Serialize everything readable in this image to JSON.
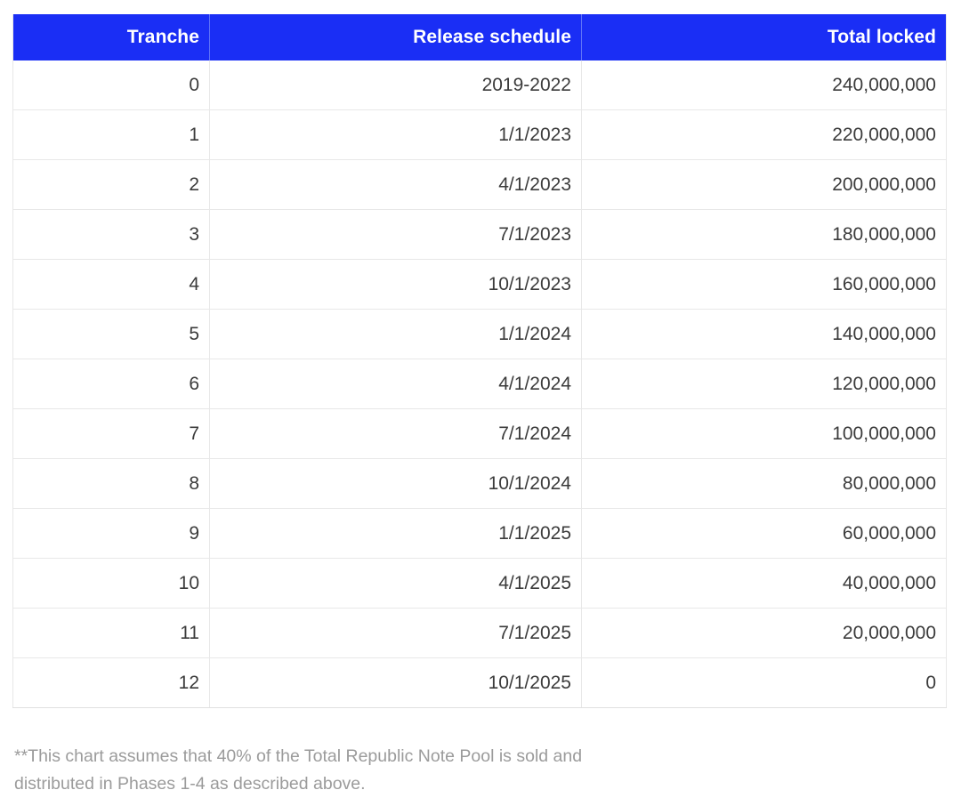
{
  "table": {
    "columns": [
      {
        "key": "tranche",
        "label": "Tranche"
      },
      {
        "key": "schedule",
        "label": "Release schedule"
      },
      {
        "key": "locked",
        "label": "Total locked"
      }
    ],
    "header_bg": "#1a2ef5",
    "header_text_color": "#ffffff",
    "body_text_color": "#3b3b3b",
    "rows": [
      {
        "tranche": "0",
        "schedule": "2019-2022",
        "locked": "240,000,000"
      },
      {
        "tranche": "1",
        "schedule": "1/1/2023",
        "locked": "220,000,000"
      },
      {
        "tranche": "2",
        "schedule": "4/1/2023",
        "locked": "200,000,000"
      },
      {
        "tranche": "3",
        "schedule": "7/1/2023",
        "locked": "180,000,000"
      },
      {
        "tranche": "4",
        "schedule": "10/1/2023",
        "locked": "160,000,000"
      },
      {
        "tranche": "5",
        "schedule": "1/1/2024",
        "locked": "140,000,000"
      },
      {
        "tranche": "6",
        "schedule": "4/1/2024",
        "locked": "120,000,000"
      },
      {
        "tranche": "7",
        "schedule": "7/1/2024",
        "locked": "100,000,000"
      },
      {
        "tranche": "8",
        "schedule": "10/1/2024",
        "locked": "80,000,000"
      },
      {
        "tranche": "9",
        "schedule": "1/1/2025",
        "locked": "60,000,000"
      },
      {
        "tranche": "10",
        "schedule": "4/1/2025",
        "locked": "40,000,000"
      },
      {
        "tranche": "11",
        "schedule": "7/1/2025",
        "locked": "20,000,000"
      },
      {
        "tranche": "12",
        "schedule": "10/1/2025",
        "locked": "0"
      }
    ]
  },
  "footnote": {
    "text": "**This chart assumes that 40% of the Total Republic Note Pool is sold and distributed in Phases 1-4 as described above.",
    "color": "#9b9b9b"
  },
  "chart_data": {
    "type": "table",
    "title": "",
    "columns": [
      "Tranche",
      "Release schedule",
      "Total locked"
    ],
    "categories": [
      "0",
      "1",
      "2",
      "3",
      "4",
      "5",
      "6",
      "7",
      "8",
      "9",
      "10",
      "11",
      "12"
    ],
    "x": [
      "2019-2022",
      "1/1/2023",
      "4/1/2023",
      "7/1/2023",
      "10/1/2023",
      "1/1/2024",
      "4/1/2024",
      "7/1/2024",
      "10/1/2024",
      "1/1/2025",
      "4/1/2025",
      "7/1/2025",
      "10/1/2025"
    ],
    "series": [
      {
        "name": "Total locked",
        "values": [
          240000000,
          220000000,
          200000000,
          180000000,
          160000000,
          140000000,
          120000000,
          100000000,
          80000000,
          60000000,
          40000000,
          20000000,
          0
        ]
      }
    ],
    "xlabel": "Release schedule",
    "ylabel": "Total locked",
    "ylim": [
      0,
      240000000
    ],
    "grid": true,
    "legend": "none",
    "annotations": [
      "**This chart assumes that 40% of the Total Republic Note Pool is sold and distributed in Phases 1-4 as described above."
    ]
  }
}
